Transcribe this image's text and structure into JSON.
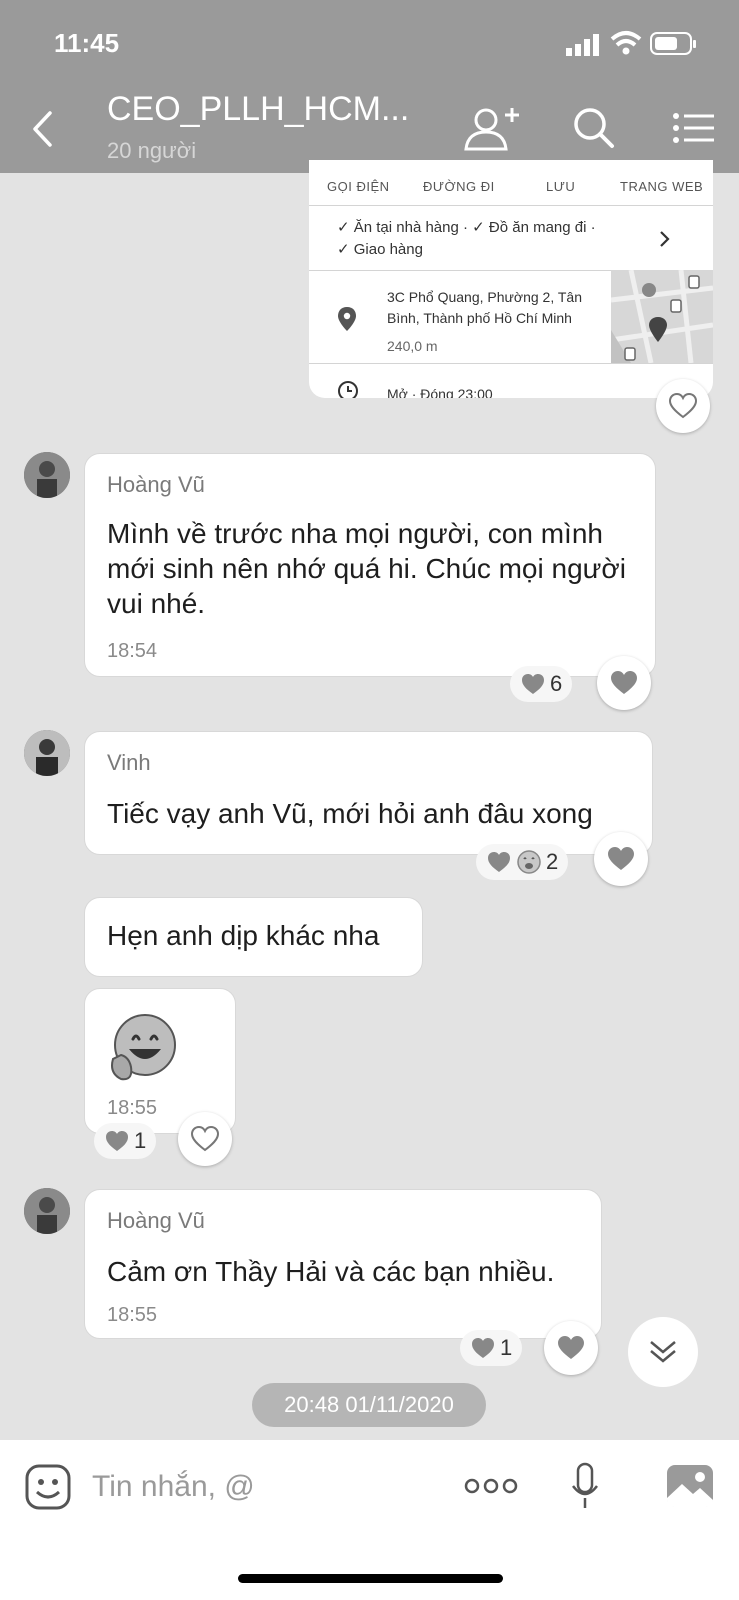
{
  "status_bar": {
    "time": "11:45"
  },
  "header": {
    "title": "CEO_PLLH_HCM...",
    "subtitle": "20 người"
  },
  "place_card": {
    "actions": [
      "GỌI ĐIỆN",
      "ĐƯỜNG ĐI",
      "LƯU",
      "TRANG WEB"
    ],
    "service_line1": "✓ Ăn tại nhà hàng · ✓ Đồ ăn mang đi ·",
    "service_line2": "✓ Giao hàng",
    "address": "3C Phổ Quang, Phường 2, Tân Bình, Thành phố Hồ Chí Minh",
    "distance": "240,0 m",
    "hours": "Mở · Đóng 23:00"
  },
  "messages": [
    {
      "sender": "Hoàng Vũ",
      "text": "Mình về trước nha mọi người, con mình mới sinh nên nhớ quá hi. Chúc mọi người vui nhé.",
      "time": "18:54",
      "reaction_count": "6"
    },
    {
      "sender": "Vinh",
      "text": "Tiếc vạy anh Vũ, mới hỏi anh đâu xong",
      "reaction_count": "2"
    },
    {
      "text": "Hẹn anh dịp khác nha"
    },
    {
      "sticker": "waving-smiley",
      "time": "18:55",
      "reaction_count": "1"
    },
    {
      "sender": "Hoàng Vũ",
      "text": "Cảm ơn Thầy Hải và các bạn nhiều.",
      "time": "18:55",
      "reaction_count": "1"
    }
  ],
  "date_separator": "20:48 01/11/2020",
  "composer": {
    "placeholder": "Tin nhắn, @"
  },
  "icons": [
    "back-icon",
    "add-member-icon",
    "search-icon",
    "menu-icon",
    "location-pin-icon",
    "chevron-right-icon",
    "heart-icon",
    "scroll-down-icon",
    "emoji-icon",
    "more-icon",
    "microphone-icon",
    "image-icon"
  ]
}
